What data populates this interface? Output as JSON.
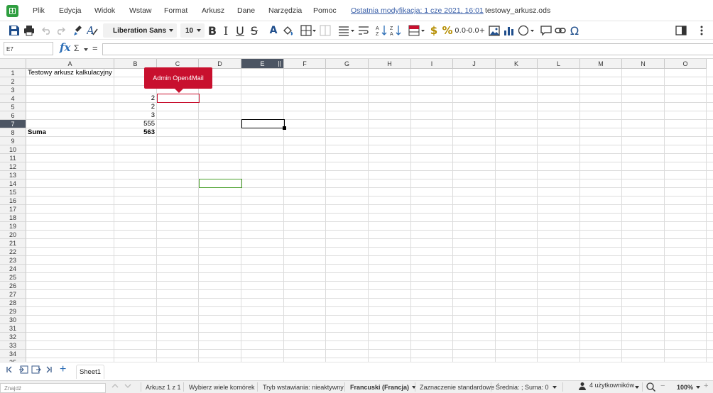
{
  "menu": {
    "items": [
      "Plik",
      "Edycja",
      "Widok",
      "Wstaw",
      "Format",
      "Arkusz",
      "Dane",
      "Narzędzia",
      "Pomoc"
    ],
    "last_modified": "Ostatnia modyfikacja: 1 cze 2021, 16:01",
    "document_name": "testowy_arkusz.ods"
  },
  "toolbar": {
    "font_name": "Liberation Sans",
    "font_size": "10",
    "icons": [
      "save-icon",
      "print-icon",
      "undo-icon",
      "redo-icon",
      "clone-formatting-icon",
      "clear-formatting-icon",
      "bold-icon",
      "italic-icon",
      "underline-icon",
      "strikethrough-icon",
      "font-color-icon",
      "background-color-icon",
      "borders-icon",
      "merge-cells-icon",
      "align-icon",
      "wrap-text-icon",
      "sort-ascending-icon",
      "sort-descending-icon",
      "conditional-format-icon",
      "currency-icon",
      "percent-icon",
      "decimal-remove-icon",
      "decimal-add-icon",
      "image-icon",
      "chart-icon",
      "shape-icon",
      "comment-icon",
      "link-icon",
      "special-char-icon",
      "sidebar-icon",
      "more-icon"
    ],
    "currency_symbol": "$",
    "percent_symbol": "%",
    "decimal_remove": "0.0-",
    "decimal_add": "0.0+",
    "omega": "Ω",
    "bold_label": "B",
    "italic_label": "I",
    "underline_label": "U",
    "strike_label": "S",
    "font_color_label": "A"
  },
  "formula_bar": {
    "name_box": "E7",
    "fx": "fx",
    "sigma": "Σ",
    "equals": "=",
    "formula": ""
  },
  "sheet": {
    "columns": [
      "A",
      "B",
      "C",
      "D",
      "E",
      "F",
      "G",
      "H",
      "I",
      "J",
      "K",
      "L",
      "M",
      "N",
      "O"
    ],
    "selected_column": "E",
    "selected_row": 7,
    "row_count": 36,
    "cells": {
      "A1": "Testowy arkusz kalkulacyjny",
      "B4": "2",
      "B5": "2",
      "B6": "3",
      "B7": "555",
      "A8": "Suma",
      "B8": "563"
    },
    "collaborator_tag": "Admin Open4Mail",
    "accent_red": "#c8102e",
    "accent_green": "#4aa02c",
    "header_selected_bg": "#4c5563"
  },
  "tabs": {
    "sheet_name": "Sheet1",
    "add_label": "+"
  },
  "status": {
    "find_placeholder": "Znajdź",
    "sheet_position": "Arkusz 1 z 1",
    "multi_select": "Wybierz wiele komórek",
    "insert_mode": "Tryb wstawiania: nieaktywny",
    "language": "Francuski (Francja)",
    "selection_mode": "Zaznaczenie standardowe",
    "stats": "Średnia: ; Suma: 0",
    "users": "4 użytkowników",
    "zoom": "100%"
  }
}
